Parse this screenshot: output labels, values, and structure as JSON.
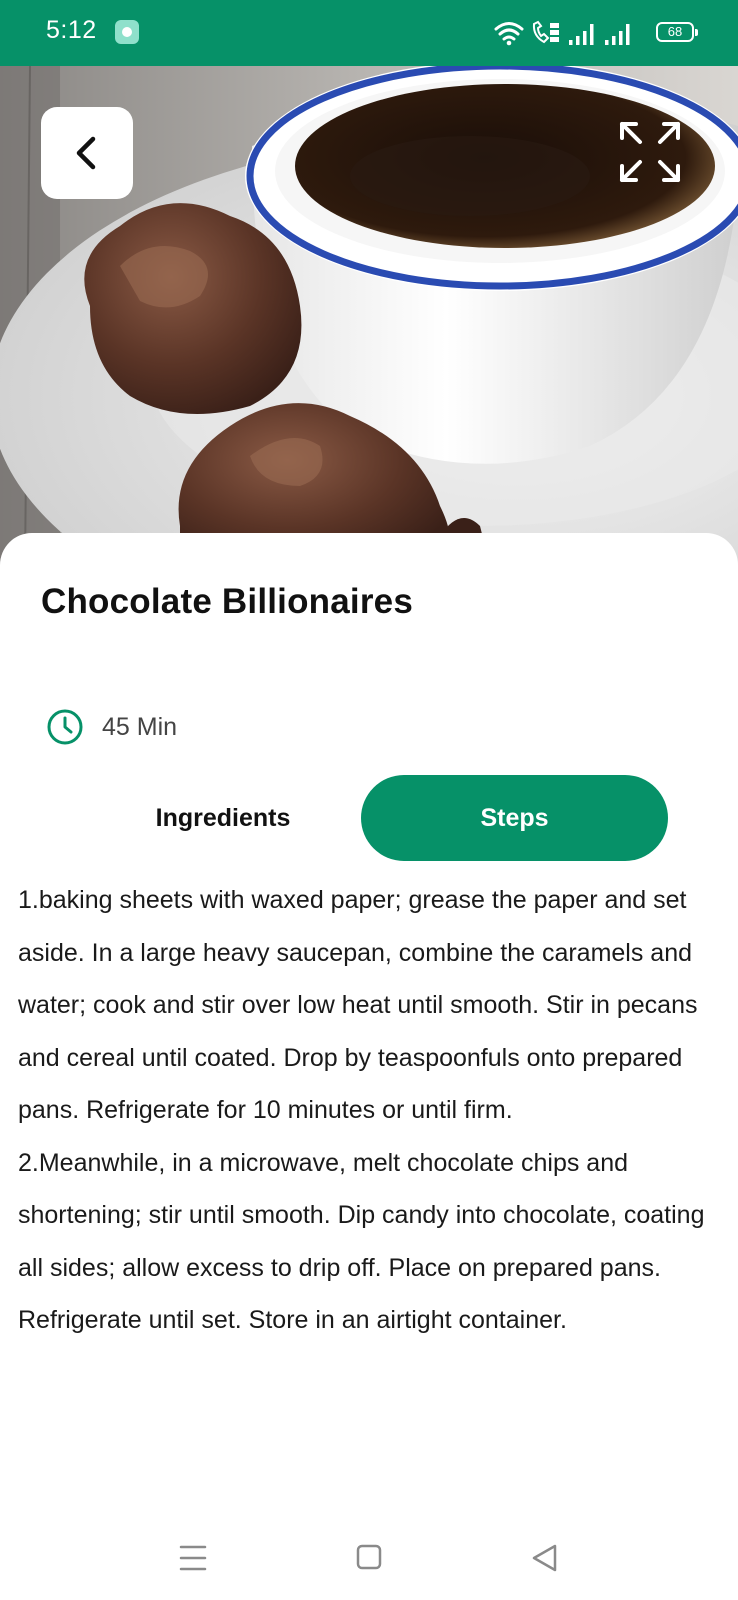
{
  "status_bar": {
    "time": "5:12",
    "battery": "68",
    "icons": [
      "app-notification-icon",
      "wifi-icon",
      "volte-call-icon",
      "signal-icon",
      "signal-icon",
      "battery-icon"
    ]
  },
  "hero": {
    "image": "coffee cup with chocolate clusters",
    "back_icon": "chevron-left-icon",
    "expand_icon": "fullscreen-expand-icon"
  },
  "recipe": {
    "title": "Chocolate Billionaires",
    "time": "45 Min",
    "time_icon": "clock-icon"
  },
  "tabs": {
    "ingredients": "Ingredients",
    "steps": "Steps",
    "active": "steps"
  },
  "steps": [
    "1.baking sheets with waxed paper; grease the paper and set aside. In a large heavy saucepan, combine the caramels and water; cook and stir over low heat until smooth. Stir in pecans and cereal until coated. Drop by teaspoonfuls onto prepared pans. Refrigerate for 10 minutes or until firm.",
    "2.Meanwhile, in a microwave, melt chocolate chips and shortening; stir until smooth. Dip candy into chocolate, coating all sides; allow excess to drip off. Place on prepared pans. Refrigerate until set. Store in an airtight container."
  ],
  "nav_bar": {
    "icons": [
      "menu-icon",
      "home-icon",
      "back-triangle-icon"
    ]
  },
  "colors": {
    "accent": "#069168",
    "text": "#111111",
    "muted_text": "#444444"
  }
}
